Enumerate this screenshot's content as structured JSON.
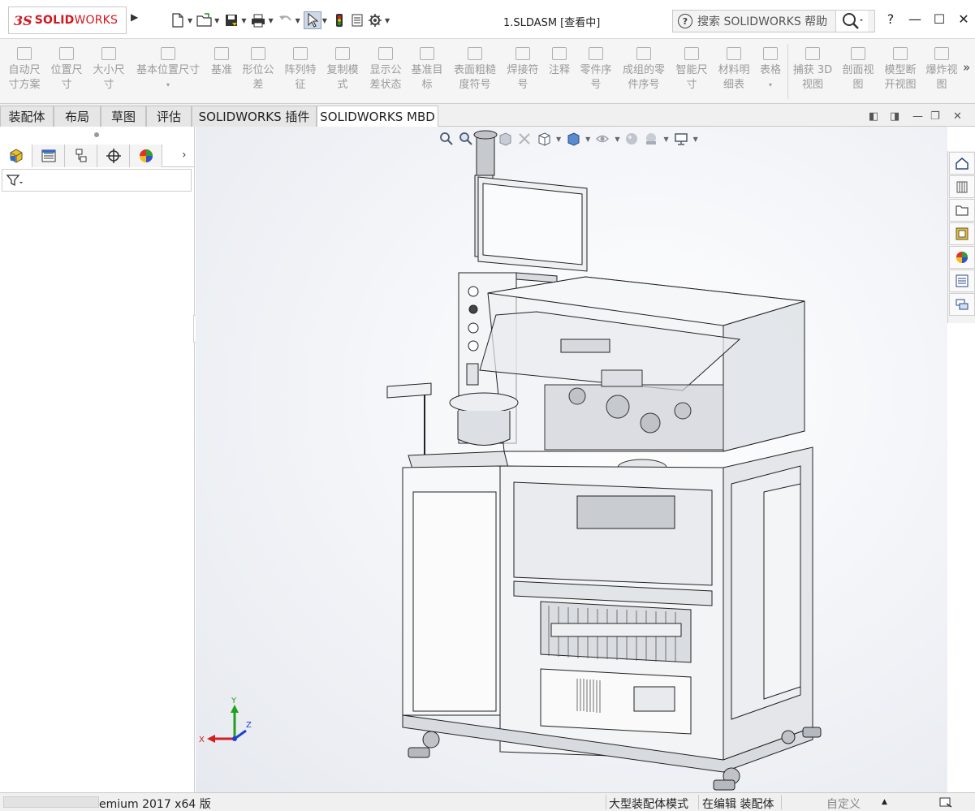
{
  "app": {
    "logo_ds": "3S",
    "logo_solid": "SOLID",
    "logo_works": "WORKS",
    "document_title": "1.SLDASM [查看中]"
  },
  "search": {
    "placeholder": "搜索 SOLIDWORKS 帮助"
  },
  "window_controls": {
    "help": "?",
    "minimize": "—",
    "maximize": "☐",
    "close": "✕"
  },
  "ribbon": {
    "items": [
      {
        "label": "自动尺\n寸方案"
      },
      {
        "label": "位置尺\n寸"
      },
      {
        "label": "大小尺\n寸"
      },
      {
        "label": "基本位置尺寸"
      },
      {
        "label": "基准"
      },
      {
        "label": "形位公\n差"
      },
      {
        "label": "阵列特\n征"
      },
      {
        "label": "复制模\n式"
      },
      {
        "label": "显示公\n差状态"
      },
      {
        "label": "基准目\n标"
      },
      {
        "label": "表面粗糙\n度符号"
      },
      {
        "label": "焊接符\n号"
      },
      {
        "label": "注释"
      },
      {
        "label": "零件序\n号"
      },
      {
        "label": "成组的零\n件序号"
      },
      {
        "label": "智能尺\n寸"
      },
      {
        "label": "材料明\n细表"
      },
      {
        "label": "表格"
      },
      {
        "label": "捕获 3D\n视图"
      },
      {
        "label": "剖面视\n图"
      },
      {
        "label": "模型断\n开视图"
      },
      {
        "label": "爆炸视\n图"
      }
    ],
    "overflow": "»"
  },
  "tabs": [
    {
      "label": "装配体"
    },
    {
      "label": "布局"
    },
    {
      "label": "草图"
    },
    {
      "label": "评估"
    },
    {
      "label": "SOLIDWORKS 插件"
    },
    {
      "label": "SOLIDWORKS MBD"
    }
  ],
  "panel": {
    "more": "›"
  },
  "triad": {
    "x": "X",
    "y": "Y",
    "z": "Z"
  },
  "status": {
    "product": "emium 2017 x64 版",
    "mode": "大型装配体模式",
    "editing": "在编辑 装配体",
    "units": "自定义"
  },
  "colors": {
    "accent_red": "#d5161d",
    "viewport_bg": "#eef0f4"
  }
}
